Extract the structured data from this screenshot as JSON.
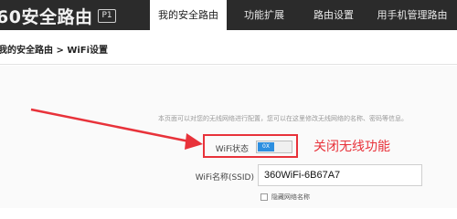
{
  "topbar": {
    "brand": "60安全路由",
    "badge": "P1",
    "tabs": [
      {
        "label": "我的安全路由",
        "active": true
      },
      {
        "label": "功能扩展",
        "active": false
      },
      {
        "label": "路由设置",
        "active": false
      },
      {
        "label": "用手机管理路由",
        "active": false
      }
    ]
  },
  "breadcrumb": "我的安全路由 > WiFi设置",
  "settings": {
    "description": "本页面可以对您的无线网络进行配置，您可以在这里修改无线网络的名称、密码等信息。",
    "wifi_status_label": "WiFi状态",
    "toggle_text": "0X",
    "ssid_label": "WiFi名称(SSID)",
    "ssid_value": "360WiFi-6B67A7",
    "hide_network_label": "隐藏网络名称"
  },
  "annotation": {
    "text": "关闭无线功能",
    "color": "#e8323a"
  },
  "colors": {
    "nav_bg": "#2b2b2b",
    "accent": "#2d8fe0",
    "annotation": "#e8323a"
  }
}
